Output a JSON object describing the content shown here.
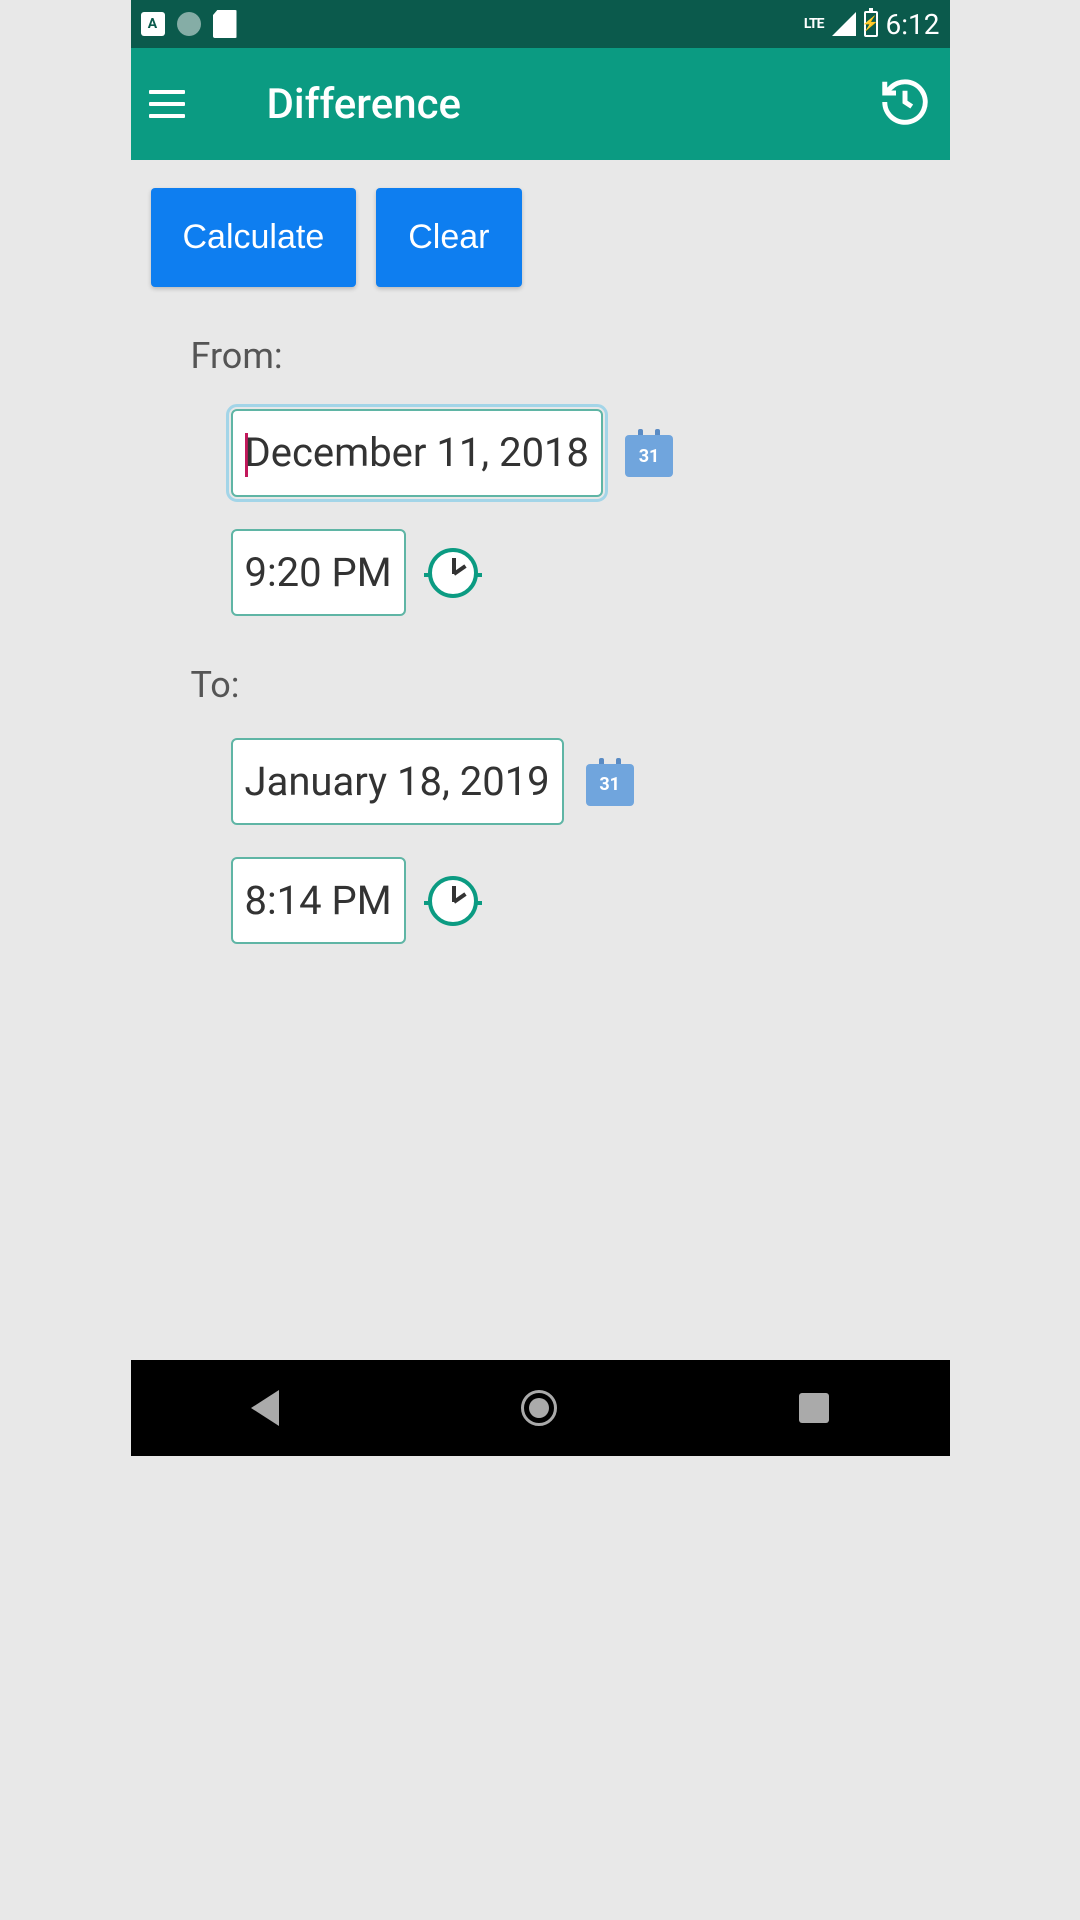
{
  "status_bar": {
    "time": "6:12",
    "network_label": "LTE"
  },
  "app_bar": {
    "title": "Difference"
  },
  "buttons": {
    "calculate": "Calculate",
    "clear": "Clear"
  },
  "form": {
    "from_label": "From:",
    "to_label": "To:",
    "from_date": "December 11, 2018",
    "from_time": "9:20 PM",
    "to_date": "January 18, 2019",
    "to_time": "8:14 PM",
    "calendar_day": "31"
  }
}
